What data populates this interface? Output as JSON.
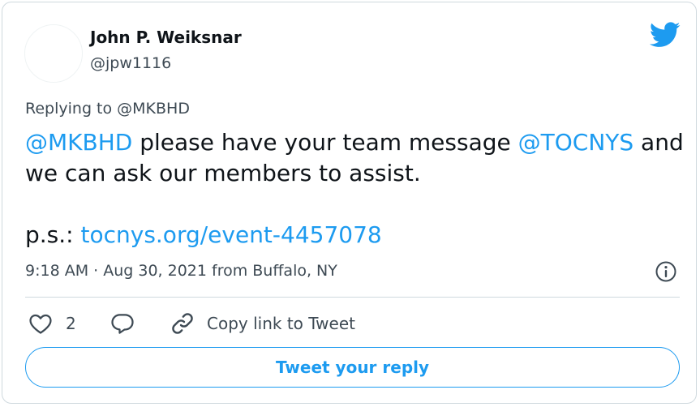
{
  "author": {
    "name": "John P. Weiksnar",
    "handle": "@jpw1116"
  },
  "replying_to": "Replying to @MKBHD",
  "tweet": {
    "mention1": "@MKBHD",
    "text1": " please have your team message ",
    "mention2": "@TOCNYS",
    "text2": " and we can ask our members to assist.",
    "ps_label": "p.s.: ",
    "ps_link": "tocnys.org/event-4457078"
  },
  "meta": "9:18 AM · Aug 30, 2021 from Buffalo, NY",
  "actions": {
    "like_count": "2",
    "copy_link_label": "Copy link to Tweet"
  },
  "reply_button_label": "Tweet your reply",
  "colors": {
    "link": "#1d9bf0",
    "text": "#0f1419",
    "secondary": "#3e4a54",
    "border": "#cfd9de"
  },
  "icons": {
    "brand": "twitter-bird-icon",
    "info": "info-icon",
    "like": "heart-icon",
    "reply": "reply-bubble-icon",
    "copy": "link-icon"
  }
}
